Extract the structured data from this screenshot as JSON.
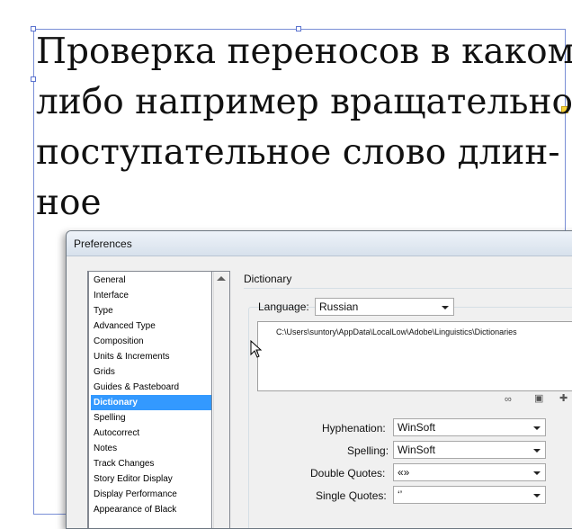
{
  "document": {
    "lines": [
      "Проверка переносов в каком-",
      "либо например вращательно-",
      "поступательное слово длин-",
      "ное"
    ]
  },
  "dialog": {
    "title": "Preferences",
    "categories": [
      "General",
      "Interface",
      "Type",
      "Advanced Type",
      "Composition",
      "Units & Increments",
      "Grids",
      "Guides & Pasteboard",
      "Dictionary",
      "Spelling",
      "Autocorrect",
      "Notes",
      "Track Changes",
      "Story Editor Display",
      "Display Performance",
      "Appearance of Black"
    ],
    "selected_category": "Dictionary",
    "section_title": "Dictionary",
    "language_label_prefix": "",
    "language_label": "Language:",
    "language_value": "Russian",
    "dictionary_path": "C:\\Users\\suntory\\AppData\\LocalLow\\Adobe\\Linguistics\\Dictionaries",
    "fields": [
      {
        "label": "Hyphenation:",
        "value": "WinSoft"
      },
      {
        "label": "Spelling:",
        "value": "WinSoft"
      },
      {
        "label": "Double Quotes:",
        "value": "«»"
      },
      {
        "label": "Single Quotes:",
        "value": "‘’"
      }
    ],
    "colors": {
      "selection": "#3399ff",
      "frame_border": "#7a8fd6",
      "port": "#f6d23a"
    }
  }
}
